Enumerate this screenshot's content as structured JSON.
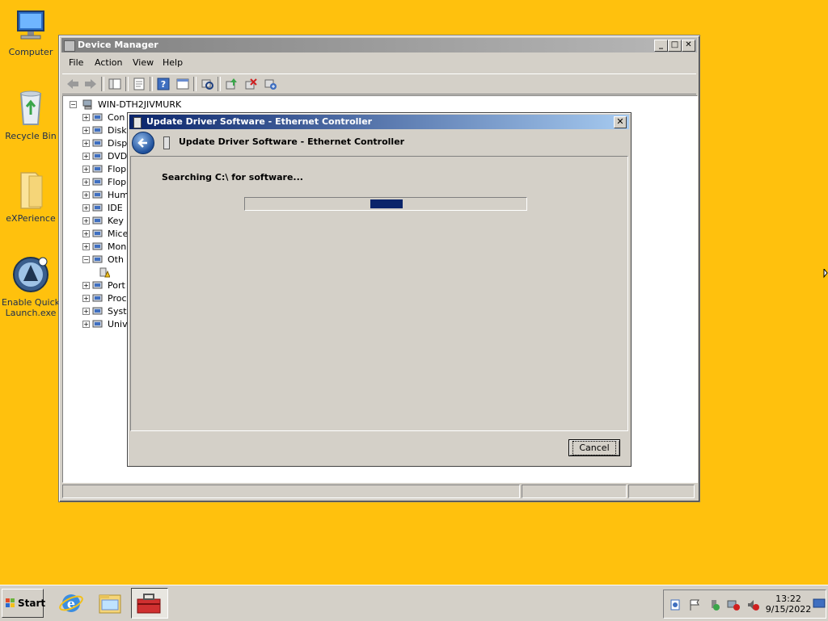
{
  "desktop": {
    "icons": [
      {
        "label": "Computer"
      },
      {
        "label": "Recycle Bin"
      },
      {
        "label": "eXPerience"
      },
      {
        "label": "Enable Quick Launch.exe"
      }
    ]
  },
  "device_manager": {
    "title": "Device Manager",
    "caption_buttons": {
      "minimize": "_",
      "maximize": "□",
      "close": "✕"
    },
    "menu": [
      "File",
      "Action",
      "View",
      "Help"
    ],
    "tree": {
      "root": "WIN-DTH2JIVMURK",
      "nodes": [
        "Con",
        "Disk",
        "Disp",
        "DVD",
        "Flop",
        "Flop",
        "Hum",
        "IDE",
        "Key",
        "Mice",
        "Mon",
        "Oth",
        "",
        "Port",
        "Proc",
        "Syst",
        "Univ"
      ]
    }
  },
  "dialog": {
    "title": "Update Driver Software - Ethernet Controller",
    "close_label": "✕",
    "header": "Update Driver Software - Ethernet Controller",
    "status_text": "Searching C:\\ for software...",
    "progress_fraction": 0.5,
    "cancel_label": "Cancel"
  },
  "taskbar": {
    "start_label": "Start",
    "clock_time": "13:22",
    "clock_date": "9/15/2022"
  },
  "colors": {
    "desktop": "#FFC10D",
    "dialog_title_start": "#0A246A",
    "dialog_title_end": "#A6CAF0",
    "progress_fill": "#0A246A"
  }
}
